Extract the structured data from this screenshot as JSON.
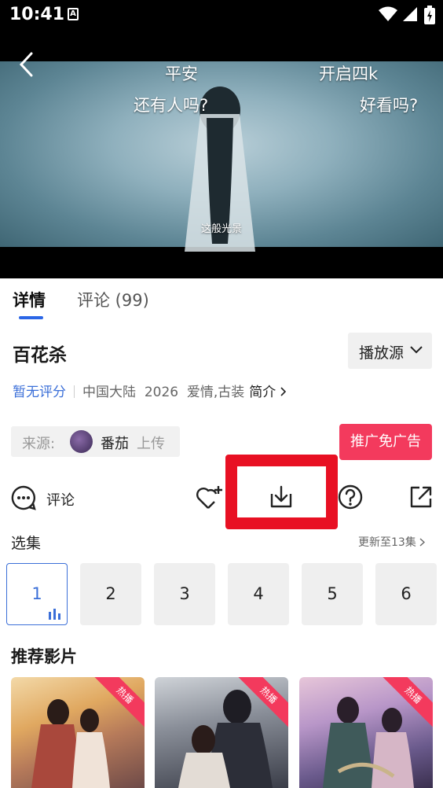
{
  "status_bar": {
    "time": "10:41",
    "notif_glyph": "A"
  },
  "video": {
    "danmaku": [
      "平安",
      "开启四k",
      "还有人吗?",
      "好看吗?"
    ],
    "subtitle": "这般光景"
  },
  "tabs": [
    {
      "label": "详情"
    },
    {
      "label": "评论 (99)"
    }
  ],
  "title": "百花杀",
  "source_button": "播放源",
  "meta": {
    "rating": "暂无评分",
    "region": "中国大陆",
    "year": "2026",
    "genres": "爱情,古装",
    "intro": "简介"
  },
  "uploader": {
    "label": "来源:",
    "name": "番茄",
    "suffix": "上传"
  },
  "promo_button": "推广免广告",
  "actions": {
    "comment_label": "评论"
  },
  "episodes": {
    "heading": "选集",
    "update": "更新至13集",
    "items": [
      "1",
      "2",
      "3",
      "4",
      "5",
      "6"
    ]
  },
  "recommend": {
    "heading": "推荐影片",
    "badge": "热播"
  },
  "colors": {
    "accent": "#3b6fd8",
    "promo": "#f33a5d",
    "highlight": "#e81023"
  }
}
